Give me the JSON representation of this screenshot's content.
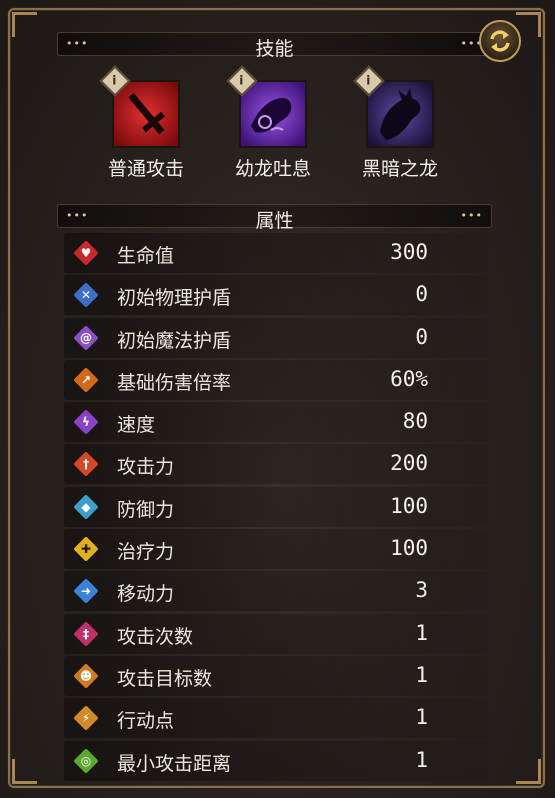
{
  "skills_section": {
    "title": "技能"
  },
  "skills": [
    {
      "name": "普通攻击",
      "icon": "sword-icon",
      "color": "#b41a1a"
    },
    {
      "name": "幼龙吐息",
      "icon": "dragon-breath-icon",
      "color": "#6a2fb0"
    },
    {
      "name": "黑暗之龙",
      "icon": "dark-dragon-icon",
      "color": "#3a2a6a"
    }
  ],
  "attributes_section": {
    "title": "属性"
  },
  "attributes": [
    {
      "label": "生命值",
      "value": "300",
      "icon": "heart-icon",
      "color": "#c8282c"
    },
    {
      "label": "初始物理护盾",
      "value": "0",
      "icon": "physical-shield-icon",
      "color": "#3d6fc8"
    },
    {
      "label": "初始魔法护盾",
      "value": "0",
      "icon": "magic-shield-icon",
      "color": "#8a4fc0"
    },
    {
      "label": "基础伤害倍率",
      "value": "60%",
      "icon": "damage-multiplier-icon",
      "color": "#d26a1e"
    },
    {
      "label": "速度",
      "value": "80",
      "icon": "speed-icon",
      "color": "#8a40c8"
    },
    {
      "label": "攻击力",
      "value": "200",
      "icon": "attack-icon",
      "color": "#d4482a"
    },
    {
      "label": "防御力",
      "value": "100",
      "icon": "defense-icon",
      "color": "#3aa0c8"
    },
    {
      "label": "治疗力",
      "value": "100",
      "icon": "heal-icon",
      "color": "#e0b020"
    },
    {
      "label": "移动力",
      "value": "3",
      "icon": "move-icon",
      "color": "#3a82d8"
    },
    {
      "label": "攻击次数",
      "value": "1",
      "icon": "attack-count-icon",
      "color": "#c0306a"
    },
    {
      "label": "攻击目标数",
      "value": "1",
      "icon": "attack-targets-icon",
      "color": "#d07a22"
    },
    {
      "label": "行动点",
      "value": "1",
      "icon": "action-point-icon",
      "color": "#d08a2a"
    },
    {
      "label": "最小攻击距离",
      "value": "1",
      "icon": "min-range-icon",
      "color": "#5aa830"
    }
  ]
}
